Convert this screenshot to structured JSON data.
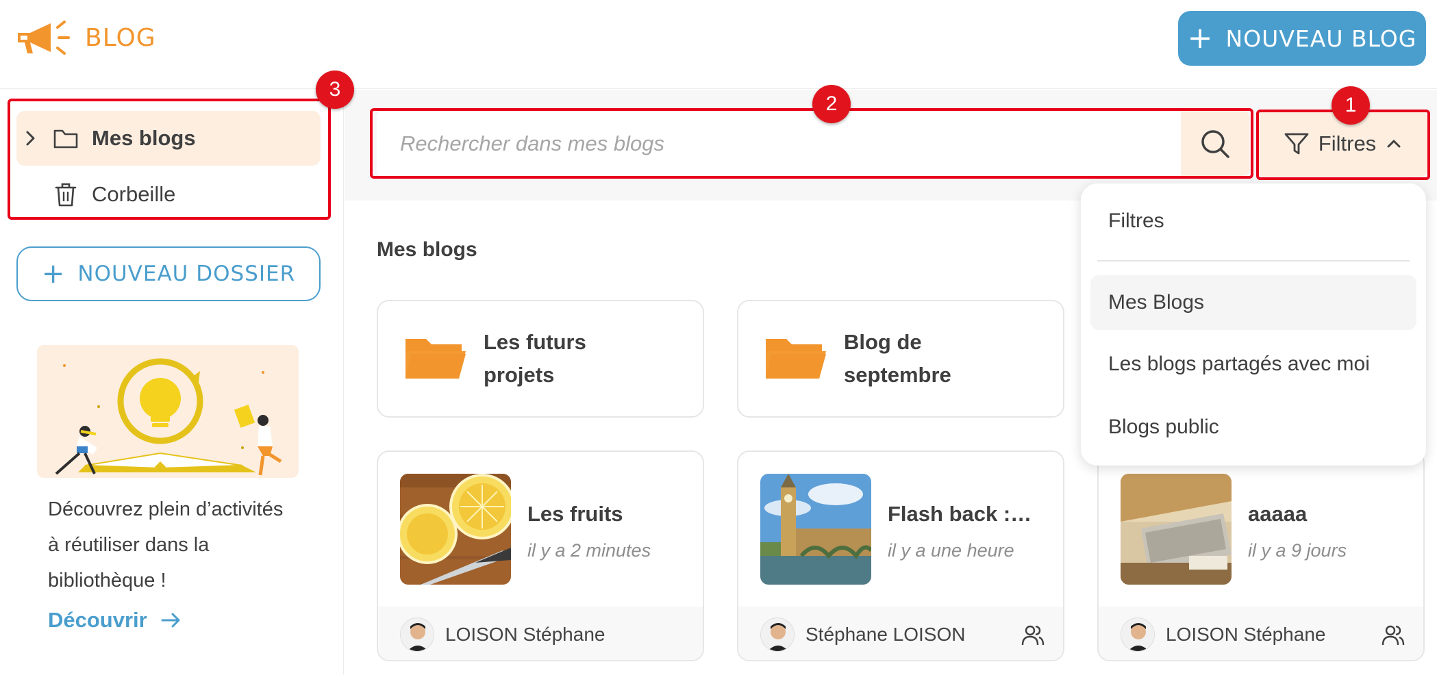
{
  "header": {
    "app_title": "BLOG",
    "new_blog_label": "NOUVEAU BLOG",
    "brand_color": "#f2952d",
    "accent_color": "#4a9ecd"
  },
  "sidebar": {
    "items": [
      {
        "label": "Mes blogs",
        "icon": "folder-icon",
        "active": true
      },
      {
        "label": "Corbeille",
        "icon": "trash-icon",
        "active": false
      }
    ],
    "new_folder_label": "NOUVEAU DOSSIER",
    "promo": {
      "text": "Découvrez plein d’activités à réutiliser dans la bibliothèque !",
      "link_label": "Découvrir"
    }
  },
  "search": {
    "placeholder": "Rechercher dans mes blogs",
    "value": ""
  },
  "filter": {
    "label": "Filtres",
    "open": true
  },
  "dropdown": {
    "header": "Filtres",
    "options": [
      {
        "label": "Mes Blogs",
        "selected": true
      },
      {
        "label": "Les blogs partagés avec moi",
        "selected": false
      },
      {
        "label": "Blogs public",
        "selected": false
      }
    ]
  },
  "main": {
    "section_title": "Mes blogs",
    "folders": [
      {
        "name": "Les futurs projets"
      },
      {
        "name": "Blog de septembre"
      }
    ],
    "blogs": [
      {
        "title": "Les fruits",
        "time": "il y a 2 minutes",
        "author": "LOISON Stéphane",
        "shared": false,
        "thumb": "lemons"
      },
      {
        "title": "Flash back :…",
        "time": "il y a une heure",
        "author": "Stéphane LOISON",
        "shared": true,
        "thumb": "london"
      },
      {
        "title": "aaaaa",
        "time": "il y a 9 jours",
        "author": "LOISON Stéphane",
        "shared": true,
        "thumb": "laptop"
      }
    ]
  },
  "annotations": [
    {
      "number": "1",
      "target": "filter-button",
      "color": "#e8001a"
    },
    {
      "number": "2",
      "target": "search-bar",
      "color": "#e8001a"
    },
    {
      "number": "3",
      "target": "sidebar-navigation",
      "color": "#e8001a"
    }
  ]
}
